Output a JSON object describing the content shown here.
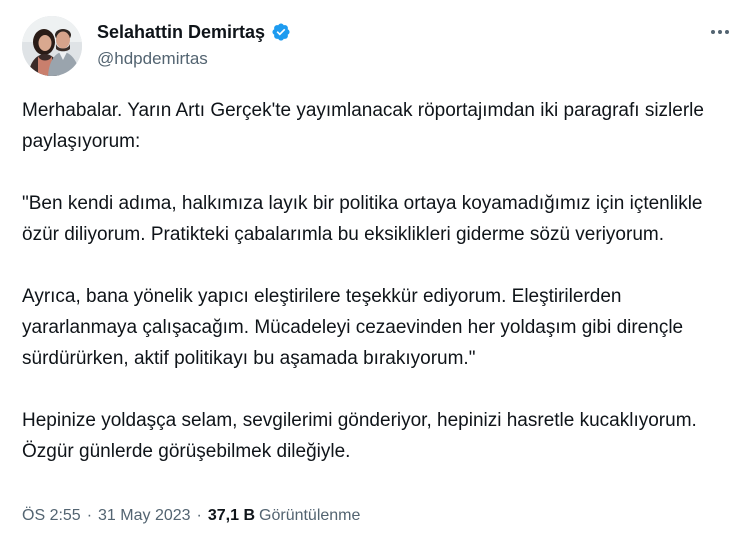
{
  "author": {
    "display_name": "Selahattin Demirtaş",
    "handle": "@hdpdemirtas",
    "verified_color": "#1d9bf0"
  },
  "icons": {
    "avatar": "profile-photo",
    "verified": "verified-badge-icon",
    "more": "more-options-icon"
  },
  "tweet": {
    "paragraphs": [
      "Merhabalar. Yarın Artı Gerçek'te yayımlanacak röportajımdan iki paragrafı sizlerle paylaşıyorum:",
      "\"Ben kendi adıma, halkımıza layık bir politika ortaya koyamadığımız için içtenlikle özür diliyorum. Pratikteki çabalarımla bu eksiklikleri giderme sözü veriyorum.",
      "Ayrıca, bana yönelik yapıcı eleştirilere teşekkür ediyorum. Eleştirilerden yararlanmaya çalışacağım. Mücadeleyi cezaevinden her yoldaşım gibi dirençle sürdürürken, aktif politikayı bu aşamada bırakıyorum.\"",
      "Hepinize yoldaşça selam, sevgilerimi gönderiyor, hepinizi hasretle kucaklıyorum. Özgür günlerde görüşebilmek dileğiyle."
    ]
  },
  "meta": {
    "time": "ÖS 2:55",
    "separator": "·",
    "date": "31 May 2023",
    "views_count": "37,1 B",
    "views_label": "Görüntülenme"
  }
}
